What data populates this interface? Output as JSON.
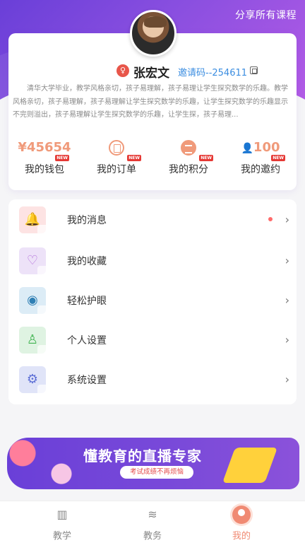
{
  "header": {
    "share_label": "分享所有课程"
  },
  "profile": {
    "name": "张宏文",
    "invite": "邀请码--254611",
    "bio": "清华大学毕业，教学风格亲切，孩子易理解，孩子易理让学生探究数学的乐趣。教学风格亲切，孩子易理解，孩子易理解让学生探究数学的乐趣，让学生探究数学的乐趣显示不完则溢出，孩子易理解让学生探究数学的乐趣，让学生探，孩子易理..."
  },
  "stats": [
    {
      "value": "¥45654",
      "label": "我的钱包",
      "badge": "NEW"
    },
    {
      "value": "",
      "label": "我的订单",
      "badge": "NEW",
      "icon": "order-icon"
    },
    {
      "value": "",
      "label": "我的积分",
      "badge": "NEW",
      "icon": "points-icon"
    },
    {
      "value": "100",
      "label": "我的邀约",
      "badge": "NEW",
      "icon": "invite-icon"
    }
  ],
  "menu": [
    {
      "label": "我的消息",
      "icon": "bell-icon",
      "color": "#f48b8b",
      "bg": "#fde3e3",
      "has_dot": true
    },
    {
      "label": "我的收藏",
      "icon": "heart-icon",
      "color": "#b06ad9",
      "bg": "#ede2f8"
    },
    {
      "label": "轻松护眼",
      "icon": "eye-icon",
      "color": "#2f7fb4",
      "bg": "#dcecf6"
    },
    {
      "label": "个人设置",
      "icon": "user-settings-icon",
      "color": "#3fb34f",
      "bg": "#dff3e2"
    },
    {
      "label": "系统设置",
      "icon": "gear-icon",
      "color": "#5d6fd6",
      "bg": "#e0e4f8"
    }
  ],
  "banner": {
    "title": "懂教育的直播专家",
    "subtitle": "考试成绩不再烦恼"
  },
  "tabs": [
    {
      "label": "教学",
      "icon": "book-icon"
    },
    {
      "label": "教务",
      "icon": "layers-icon"
    },
    {
      "label": "我的",
      "icon": "profile-icon",
      "active": true
    }
  ]
}
